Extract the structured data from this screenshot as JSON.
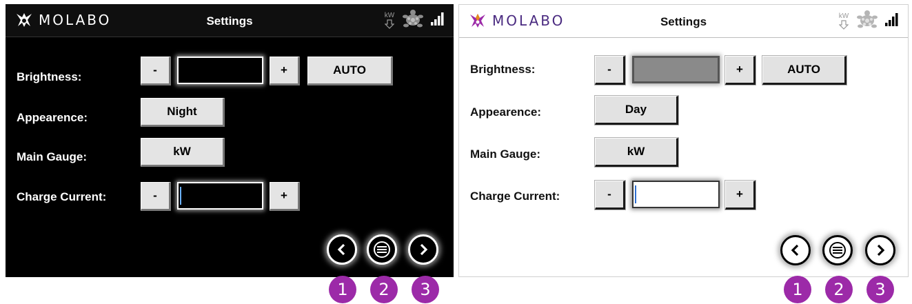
{
  "colors": {
    "badge": "#9c2aa8",
    "logo_light": "#4a2a80"
  },
  "screens": [
    {
      "theme": "dark",
      "logo": "MOLABO",
      "title": "Settings",
      "status": {
        "kw_label": "kW",
        "icons": [
          "kw-down-arrow-icon",
          "turtle-icon",
          "signal-bars-icon"
        ]
      },
      "brightness": {
        "label": "Brightness:",
        "minus": "-",
        "plus": "+",
        "auto": "AUTO",
        "level": 0
      },
      "appearance": {
        "label": "Appearence:",
        "value": "Night"
      },
      "main_gauge": {
        "label": "Main Gauge:",
        "value": "kW"
      },
      "charge_current": {
        "label": "Charge Current:",
        "minus": "-",
        "plus": "+"
      },
      "nav": [
        "back-icon",
        "menu-icon",
        "forward-icon"
      ]
    },
    {
      "theme": "light",
      "logo": "MOLABO",
      "title": "Settings",
      "status": {
        "kw_label": "kW",
        "icons": [
          "kw-down-arrow-icon",
          "turtle-icon",
          "signal-bars-icon"
        ]
      },
      "brightness": {
        "label": "Brightness:",
        "minus": "-",
        "plus": "+",
        "auto": "AUTO",
        "level": 1
      },
      "appearance": {
        "label": "Appearence:",
        "value": "Day"
      },
      "main_gauge": {
        "label": "Main Gauge:",
        "value": "kW"
      },
      "charge_current": {
        "label": "Charge Current:",
        "minus": "-",
        "plus": "+"
      },
      "nav": [
        "back-icon",
        "menu-icon",
        "forward-icon"
      ]
    }
  ],
  "badges": [
    "1",
    "2",
    "3",
    "1",
    "2",
    "3"
  ]
}
